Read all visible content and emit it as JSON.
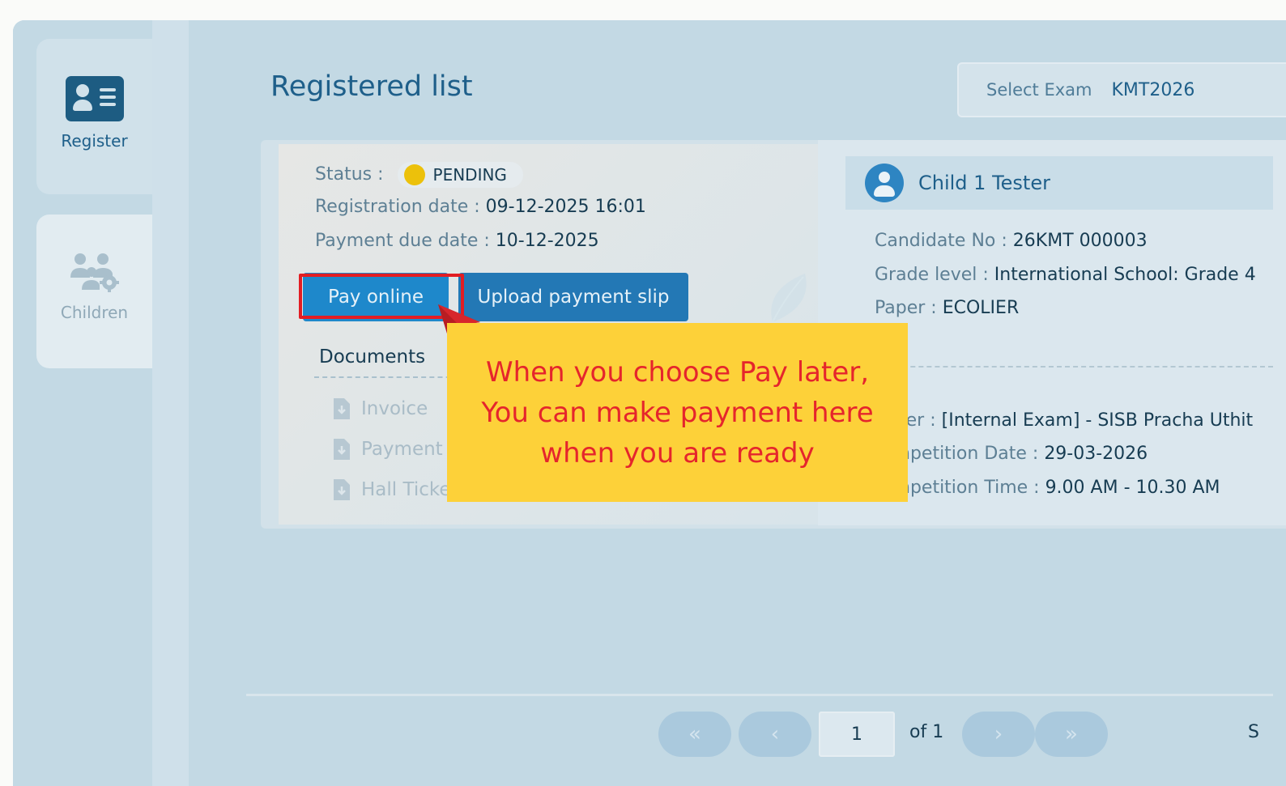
{
  "sidebar": {
    "items": [
      {
        "label": "Register",
        "icon": "id-card-icon"
      },
      {
        "label": "Children",
        "icon": "children-settings-icon"
      }
    ]
  },
  "page": {
    "title": "Registered list"
  },
  "exam_select": {
    "label": "Select Exam",
    "value": "KMT2026"
  },
  "registration": {
    "status_label": "Status :",
    "status_value": "PENDING",
    "status_color": "#ecc10b",
    "reg_date_label": "Registration date :",
    "reg_date_value": "09-12-2025 16:01",
    "due_date_label": "Payment due date :",
    "due_date_value": "10-12-2025",
    "pay_online_label": "Pay online",
    "upload_slip_label": "Upload payment slip",
    "documents_title": "Documents",
    "documents": [
      "Invoice",
      "Payment",
      "Hall Ticke"
    ]
  },
  "callout": {
    "lines": [
      "When you choose Pay later,",
      "You can make payment here",
      "when you are ready"
    ],
    "background": "#fdd139",
    "text_color": "#e5252c"
  },
  "child": {
    "name": "Child 1 Tester",
    "fields": [
      {
        "label": "Candidate No :",
        "value": "26KMT 000003"
      },
      {
        "label": "Grade level :",
        "value": "International School: Grade 4"
      },
      {
        "label": "Paper :",
        "value": "ECOLIER"
      }
    ],
    "exam_fields": [
      {
        "label": "ter :",
        "value": "[Internal Exam] - SISB Pracha Uthit"
      },
      {
        "label": "npetition Date :",
        "value": "29-03-2026"
      },
      {
        "label": "npetition Time :",
        "value": "9.00 AM - 10.30 AM"
      }
    ]
  },
  "pagination": {
    "first": "«",
    "prev": "‹",
    "current": "1",
    "of_text": "of 1",
    "next": "›",
    "last": "»",
    "right_cut": "S"
  },
  "colors": {
    "accent": "#1e5f8a",
    "highlight": "#e21d23",
    "primary_button": "#1e88cb"
  }
}
